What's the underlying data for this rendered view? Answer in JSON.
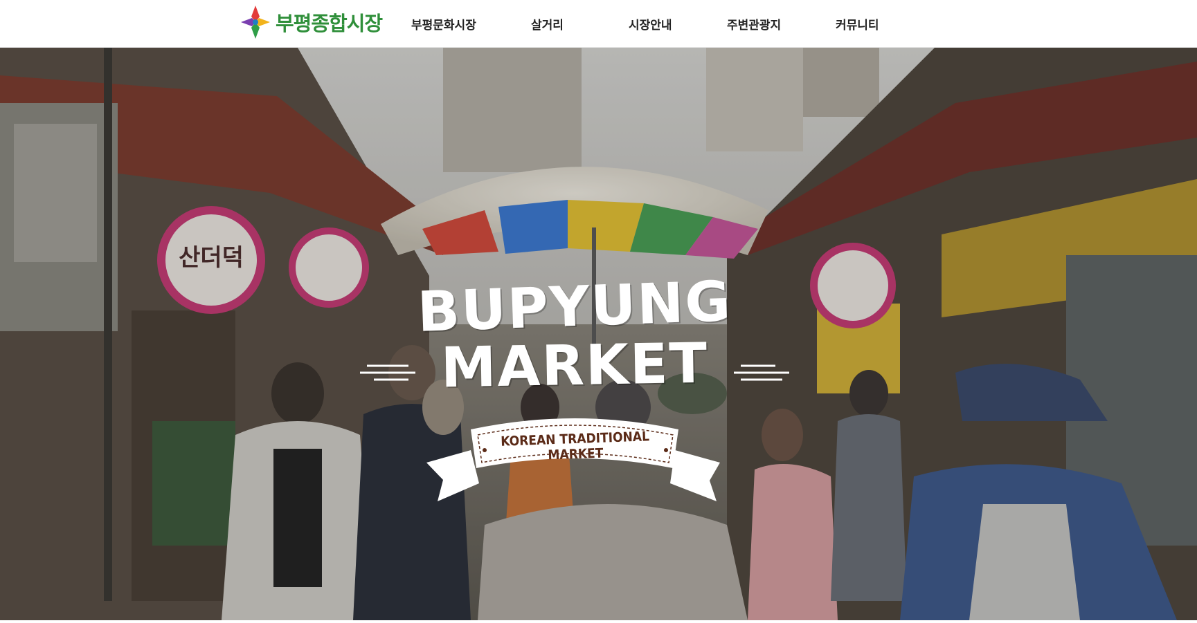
{
  "header": {
    "logo_text": "부평종합시장",
    "nav": [
      "부평문화시장",
      "살거리",
      "시장안내",
      "주변관광지",
      "커뮤니티"
    ]
  },
  "hero": {
    "title_line1": "BUPYUNG",
    "title_line2": "MARKET",
    "ribbon_text": "KOREAN TRADITIONAL MARKET",
    "signs": [
      "산더덕"
    ]
  },
  "colors": {
    "logo_green": "#2c9a3f",
    "logo_blue": "#1f7fc4",
    "ribbon_text": "#5b2b18",
    "nav_text": "#222222"
  }
}
